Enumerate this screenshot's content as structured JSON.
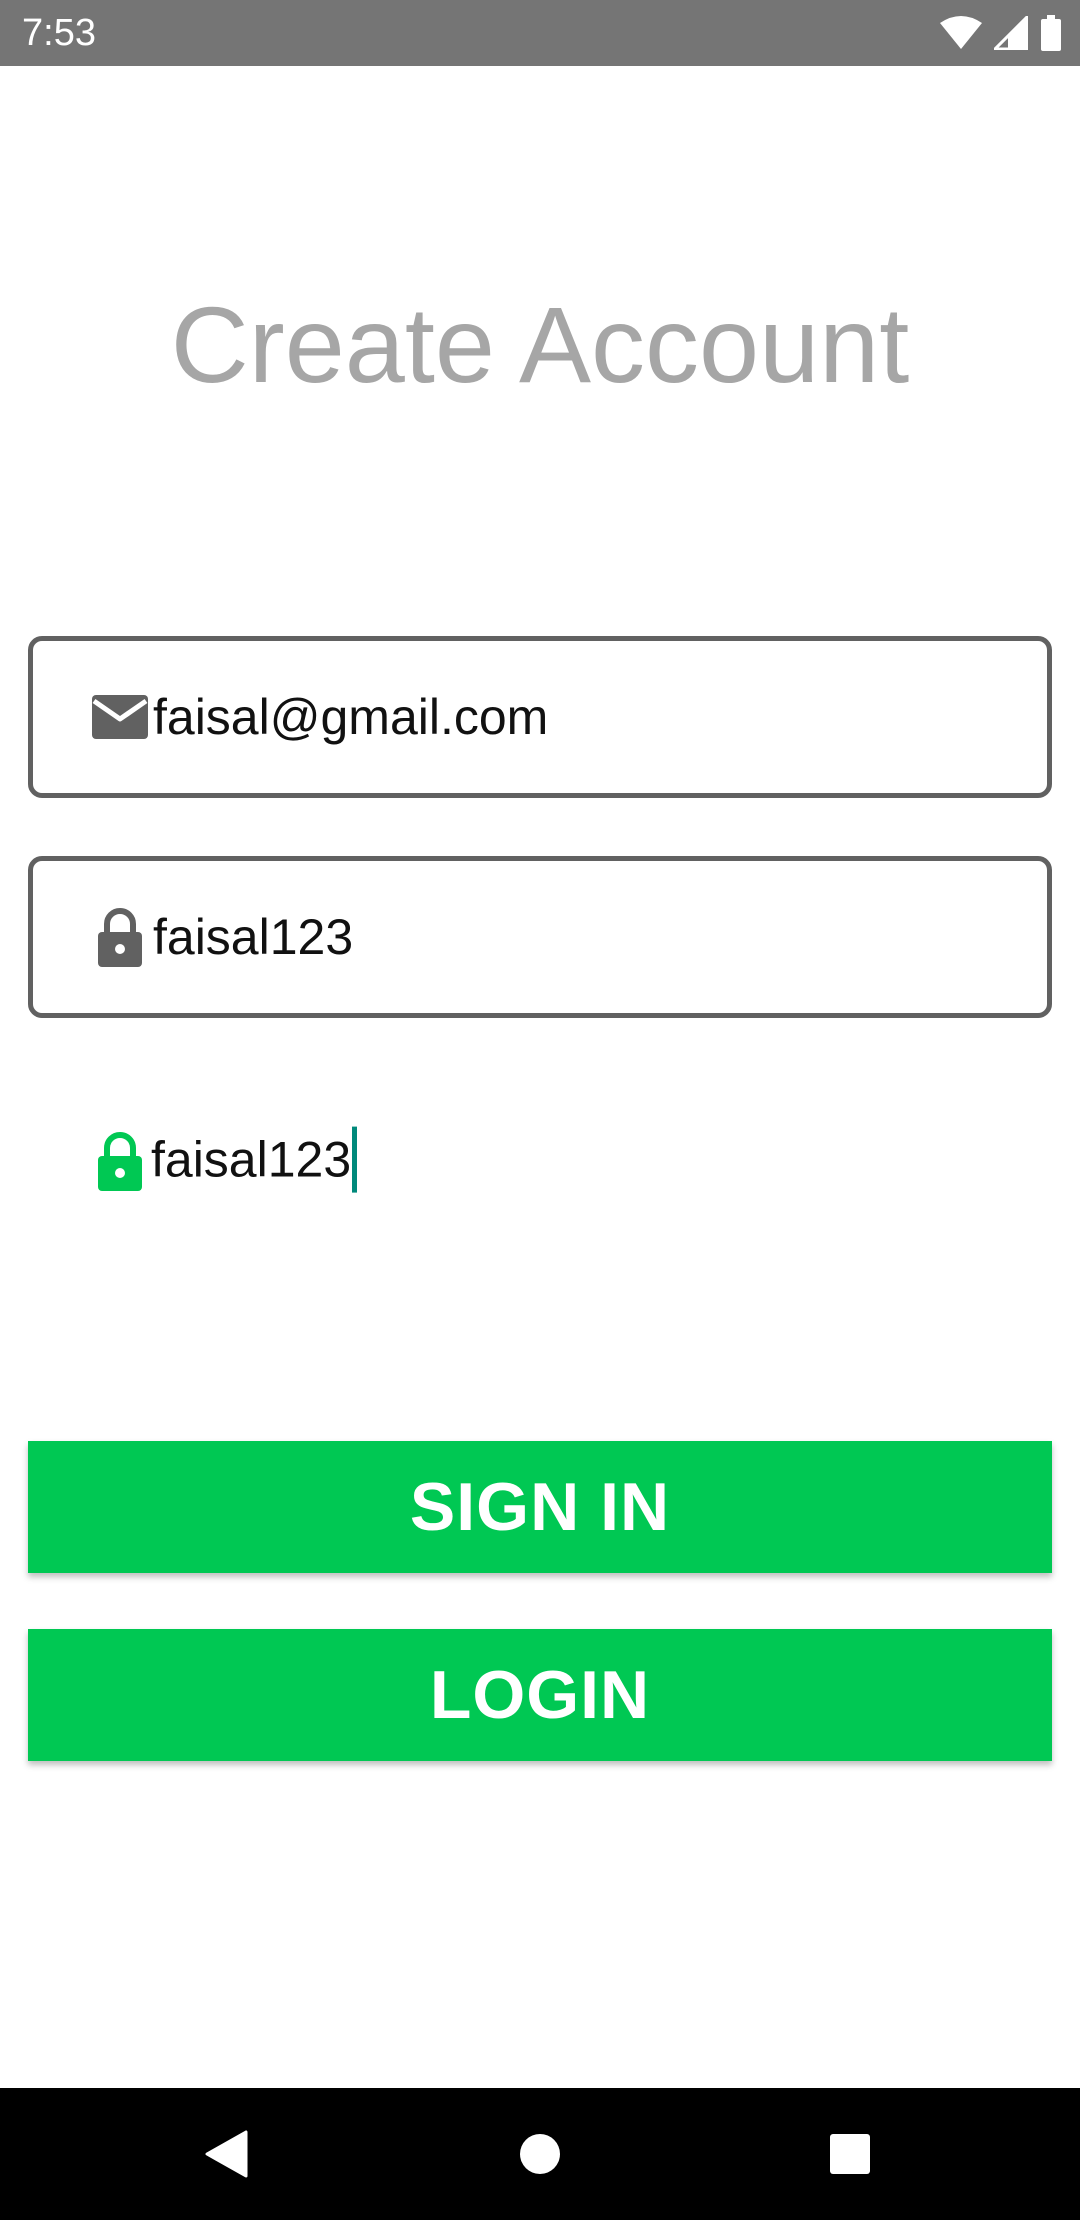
{
  "status_bar": {
    "time": "7:53",
    "icons": [
      "wifi-icon",
      "cellular-signal-icon",
      "battery-icon"
    ]
  },
  "title": "Create Account",
  "fields": [
    {
      "icon": "email-icon",
      "value": "faisal@gmail.com",
      "icon_color": "#616161"
    },
    {
      "icon": "lock-icon",
      "value": "faisal123",
      "icon_color": "#616161"
    },
    {
      "icon": "lock-icon",
      "value": "faisal123",
      "icon_color": "#00c853",
      "focused": true
    }
  ],
  "buttons": {
    "sign_in": "SIGN IN",
    "login": "LOGIN"
  },
  "colors": {
    "accent": "#00c853",
    "cursor": "#00897b",
    "status_bar": "#757575",
    "title": "#a6a6a6"
  },
  "nav_bar": {
    "icons": [
      "back-icon",
      "home-icon",
      "recents-icon"
    ]
  }
}
